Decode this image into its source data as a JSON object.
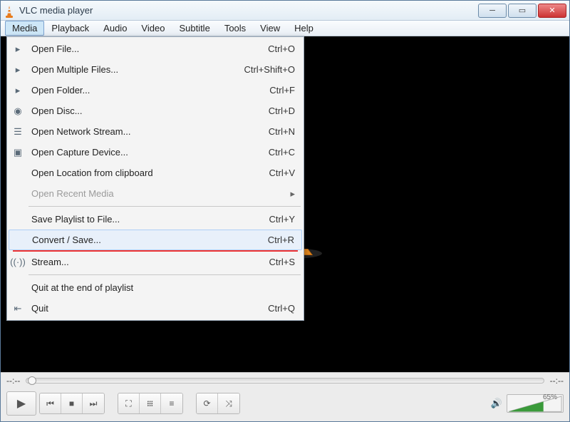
{
  "window": {
    "title": "VLC media player"
  },
  "menubar": {
    "items": [
      {
        "label": "Media",
        "active": true
      },
      {
        "label": "Playback"
      },
      {
        "label": "Audio"
      },
      {
        "label": "Video"
      },
      {
        "label": "Subtitle"
      },
      {
        "label": "Tools"
      },
      {
        "label": "View"
      },
      {
        "label": "Help"
      }
    ]
  },
  "dropdown": {
    "items": [
      {
        "icon": "file-icon",
        "label": "Open File...",
        "shortcut": "Ctrl+O"
      },
      {
        "icon": "files-icon",
        "label": "Open Multiple Files...",
        "shortcut": "Ctrl+Shift+O"
      },
      {
        "icon": "folder-icon",
        "label": "Open Folder...",
        "shortcut": "Ctrl+F"
      },
      {
        "icon": "disc-icon",
        "label": "Open Disc...",
        "shortcut": "Ctrl+D"
      },
      {
        "icon": "network-icon",
        "label": "Open Network Stream...",
        "shortcut": "Ctrl+N"
      },
      {
        "icon": "capture-icon",
        "label": "Open Capture Device...",
        "shortcut": "Ctrl+C"
      },
      {
        "icon": "",
        "label": "Open Location from clipboard",
        "shortcut": "Ctrl+V"
      },
      {
        "icon": "",
        "label": "Open Recent Media",
        "shortcut": "",
        "disabled": true,
        "submenu": true
      },
      {
        "sep": true
      },
      {
        "icon": "",
        "label": "Save Playlist to File...",
        "shortcut": "Ctrl+Y"
      },
      {
        "icon": "",
        "label": "Convert / Save...",
        "shortcut": "Ctrl+R",
        "highlight": true,
        "redline": true
      },
      {
        "icon": "stream-icon",
        "label": "Stream...",
        "shortcut": "Ctrl+S"
      },
      {
        "sep": true
      },
      {
        "icon": "",
        "label": "Quit at the end of playlist",
        "shortcut": ""
      },
      {
        "icon": "quit-icon",
        "label": "Quit",
        "shortcut": "Ctrl+Q"
      }
    ]
  },
  "seek": {
    "left": "--:--",
    "right": "--:--"
  },
  "volume": {
    "percent_label": "65%",
    "percent": 65,
    "icon": "speaker-icon"
  },
  "controls": {
    "play": "play-icon",
    "prev": "prev-icon",
    "stop": "stop-icon",
    "next": "next-icon",
    "fullscreen": "fullscreen-icon",
    "ext": "equalizer-icon",
    "playlist": "playlist-icon",
    "loop": "loop-icon",
    "shuffle": "shuffle-icon"
  }
}
